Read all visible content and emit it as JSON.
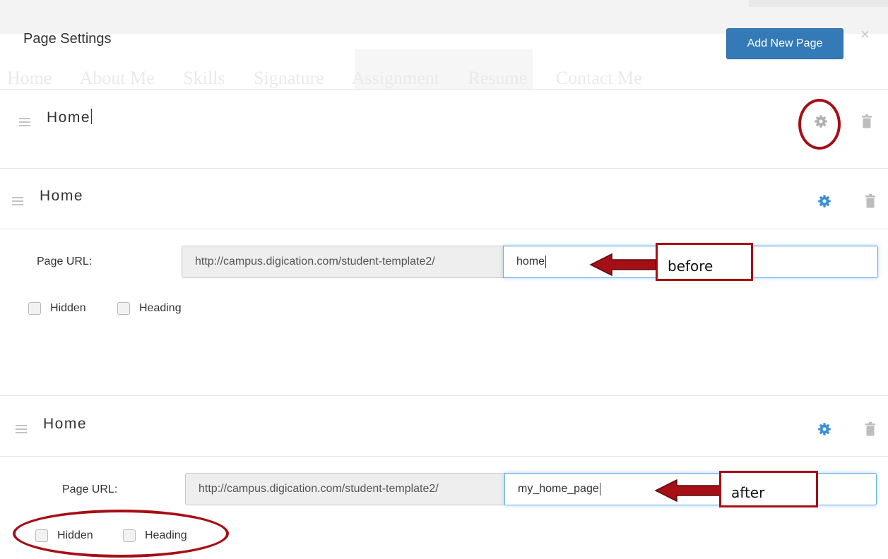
{
  "modal": {
    "title": "Page Settings",
    "add_button": "Add New Page",
    "close": "×"
  },
  "background_nav": [
    "Home",
    "About Me",
    "Skills",
    "Signature",
    "Assignment",
    "Resume",
    "Contact Me"
  ],
  "rows": [
    {
      "title": "Home"
    },
    {
      "title": "Home",
      "url_label": "Page URL:",
      "url_prefix": "http://campus.digication.com/student-template2/",
      "url_value": "home",
      "hidden_label": "Hidden",
      "heading_label": "Heading"
    },
    {
      "title": "Home",
      "url_label": "Page URL:",
      "url_prefix": "http://campus.digication.com/student-template2/",
      "url_value": "my_home_page",
      "hidden_label": "Hidden",
      "heading_label": "Heading"
    }
  ],
  "annotations": {
    "before": "before",
    "after": "after"
  },
  "colors": {
    "primary": "#337ab7",
    "gear_active": "#3a8fd9",
    "gear_inactive": "#b0b0b0",
    "trash": "#bdbdbd",
    "annotation": "#a50f15"
  },
  "icons": {
    "drag": "drag-handle-icon",
    "gear": "gear-icon",
    "trash": "trash-icon",
    "close": "close-icon",
    "arrow": "arrow-left-icon"
  }
}
